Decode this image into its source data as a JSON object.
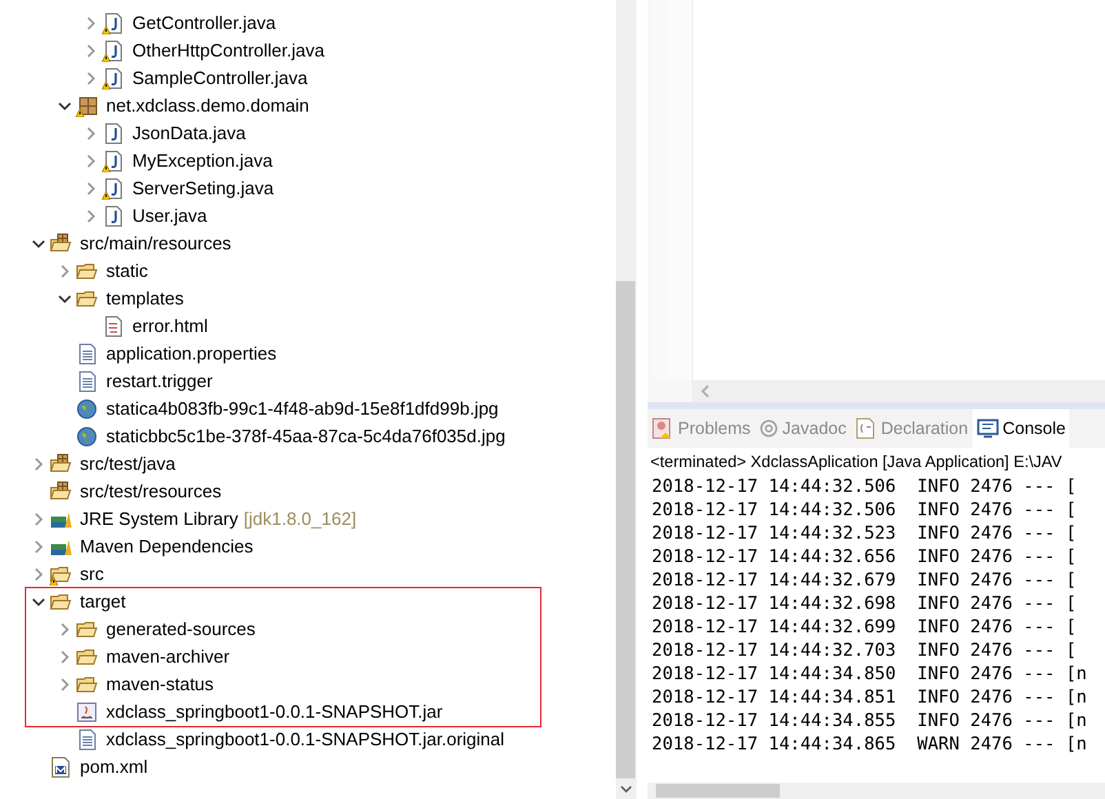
{
  "project_explorer": {
    "tree": [
      {
        "children": [
          {
            "children": [
              {
                "label": "GetController.java",
                "kind": "java",
                "expanded": false,
                "warning": true
              },
              {
                "label": "OtherHttpController.java",
                "kind": "java",
                "expanded": false,
                "warning": true
              },
              {
                "label": "SampleController.java",
                "kind": "java",
                "expanded": false,
                "warning": true
              }
            ]
          },
          {
            "label": "net.xdclass.demo.domain",
            "kind": "package",
            "expanded": true,
            "warning": true,
            "children": [
              {
                "label": "JsonData.java",
                "kind": "java",
                "expanded": false,
                "warning": false
              },
              {
                "label": "MyException.java",
                "kind": "java",
                "expanded": false,
                "warning": true
              },
              {
                "label": "ServerSeting.java",
                "kind": "java",
                "expanded": false,
                "warning": true
              },
              {
                "label": "User.java",
                "kind": "java",
                "expanded": false,
                "warning": false
              }
            ]
          }
        ]
      },
      {
        "label": "src/main/resources",
        "kind": "source-folder",
        "expanded": true,
        "warning": false,
        "children": [
          {
            "label": "static",
            "kind": "folder",
            "expanded": false,
            "warning": false
          },
          {
            "label": "templates",
            "kind": "folder",
            "expanded": true,
            "warning": false,
            "children": [
              {
                "label": "error.html",
                "kind": "html",
                "warning": false
              }
            ]
          },
          {
            "label": "application.properties",
            "kind": "text",
            "warning": false
          },
          {
            "label": "restart.trigger",
            "kind": "text",
            "warning": false
          },
          {
            "label": "statica4b083fb-99c1-4f48-ab9d-15e8f1dfd99b.jpg",
            "kind": "image",
            "warning": false
          },
          {
            "label": "staticbbc5c1be-378f-45aa-87ca-5c4da76f035d.jpg",
            "kind": "image",
            "warning": false
          }
        ]
      },
      {
        "label": "src/test/java",
        "kind": "source-folder",
        "expanded": false,
        "warning": false
      },
      {
        "label": "src/test/resources",
        "kind": "source-folder",
        "warning": false
      },
      {
        "label": "JRE System Library",
        "decoration": "[jdk1.8.0_162]",
        "kind": "library",
        "expanded": false,
        "warning": false
      },
      {
        "label": "Maven Dependencies",
        "kind": "library",
        "expanded": false,
        "warning": false
      },
      {
        "label": "src",
        "kind": "folder",
        "expanded": false,
        "warning": true
      },
      {
        "label": "target",
        "kind": "folder",
        "expanded": true,
        "warning": false,
        "boxed": true,
        "children": [
          {
            "label": "generated-sources",
            "kind": "folder",
            "expanded": false,
            "warning": false,
            "boxed": true
          },
          {
            "label": "maven-archiver",
            "kind": "folder",
            "expanded": false,
            "warning": false,
            "boxed": true
          },
          {
            "label": "maven-status",
            "kind": "folder",
            "expanded": false,
            "warning": false,
            "boxed": true
          },
          {
            "label": "xdclass_springboot1-0.0.1-SNAPSHOT.jar",
            "kind": "jar",
            "warning": false,
            "boxed": true
          },
          {
            "label": "xdclass_springboot1-0.0.1-SNAPSHOT.jar.original",
            "kind": "text",
            "warning": false,
            "boxed": false
          }
        ]
      },
      {
        "label": "pom.xml",
        "kind": "pom",
        "warning": false
      }
    ]
  },
  "view_tabs": [
    {
      "label": "Problems",
      "kind": "problems",
      "selected": false
    },
    {
      "label": "Javadoc",
      "kind": "javadoc",
      "selected": false
    },
    {
      "label": "Declaration",
      "kind": "declaration",
      "selected": false
    },
    {
      "label": "Console",
      "kind": "console",
      "selected": true
    }
  ],
  "console": {
    "header": "<terminated> XdclassAplication [Java Application] E:\\JAV",
    "lines": [
      "2018-12-17 14:44:32.506  INFO 2476 --- [",
      "2018-12-17 14:44:32.506  INFO 2476 --- [",
      "2018-12-17 14:44:32.523  INFO 2476 --- [",
      "2018-12-17 14:44:32.656  INFO 2476 --- [",
      "2018-12-17 14:44:32.679  INFO 2476 --- [",
      "2018-12-17 14:44:32.698  INFO 2476 --- [",
      "2018-12-17 14:44:32.699  INFO 2476 --- [",
      "2018-12-17 14:44:32.703  INFO 2476 --- [",
      "2018-12-17 14:44:34.850  INFO 2476 --- [n",
      "2018-12-17 14:44:34.851  INFO 2476 --- [n",
      "2018-12-17 14:44:34.855  INFO 2476 --- [n",
      "2018-12-17 14:44:34.865  WARN 2476 --- [n"
    ]
  }
}
